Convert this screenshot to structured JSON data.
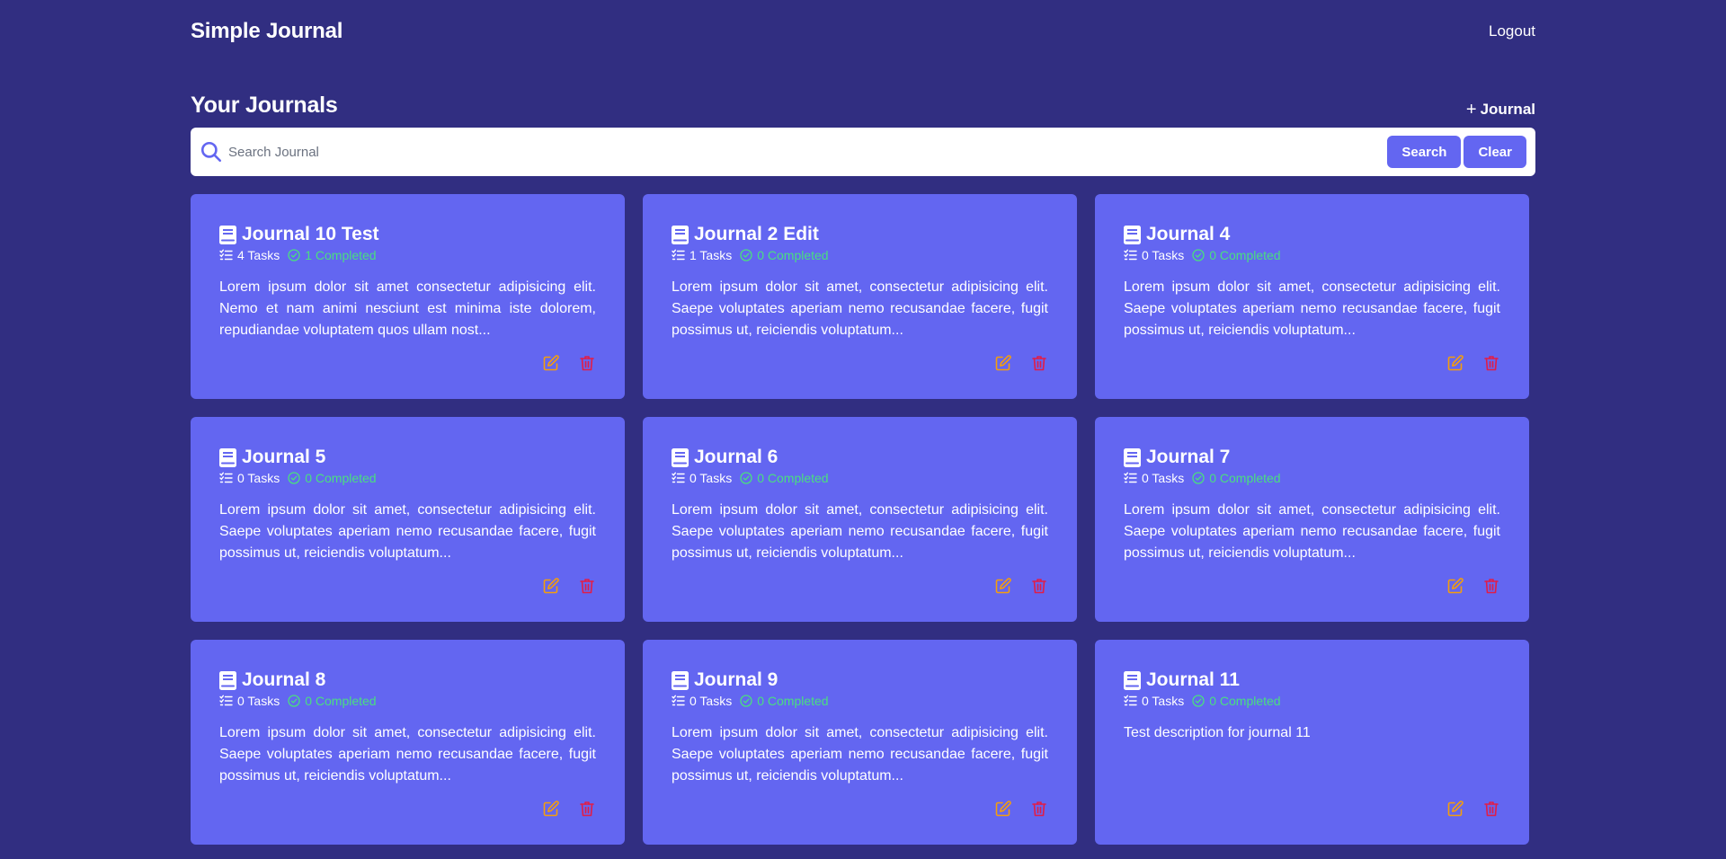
{
  "app": {
    "title": "Simple Journal",
    "logout_label": "Logout"
  },
  "page": {
    "title": "Your Journals",
    "add_label": "Journal"
  },
  "search": {
    "placeholder": "Search Journal",
    "value": "",
    "search_label": "Search",
    "clear_label": "Clear"
  },
  "colors": {
    "background": "#312e81",
    "card": "#6366f1",
    "completed": "#4ade80",
    "edit": "#f59e0b",
    "delete": "#e11d48"
  },
  "icons": {
    "book": "book-icon",
    "tasks": "tasks-list-icon",
    "completed": "check-circle-icon",
    "edit": "edit-icon",
    "delete": "trash-icon",
    "search": "search-icon",
    "add": "plus-icon"
  },
  "journals": [
    {
      "title": "Journal 10 Test",
      "tasks": "4 Tasks",
      "completed": "1 Completed",
      "description": "Lorem ipsum dolor sit amet consectetur adipisicing elit. Nemo et nam animi nesciunt est minima iste dolorem, repudiandae voluptatem quos ullam nost..."
    },
    {
      "title": "Journal 2 Edit",
      "tasks": "1 Tasks",
      "completed": "0 Completed",
      "description": "Lorem ipsum dolor sit amet, consectetur adipisicing elit. Saepe voluptates aperiam nemo recusandae facere, fugit possimus ut, reiciendis voluptatum..."
    },
    {
      "title": "Journal 4",
      "tasks": "0 Tasks",
      "completed": "0 Completed",
      "description": "Lorem ipsum dolor sit amet, consectetur adipisicing elit. Saepe voluptates aperiam nemo recusandae facere, fugit possimus ut, reiciendis voluptatum..."
    },
    {
      "title": "Journal 5",
      "tasks": "0 Tasks",
      "completed": "0 Completed",
      "description": "Lorem ipsum dolor sit amet, consectetur adipisicing elit. Saepe voluptates aperiam nemo recusandae facere, fugit possimus ut, reiciendis voluptatum..."
    },
    {
      "title": "Journal 6",
      "tasks": "0 Tasks",
      "completed": "0 Completed",
      "description": "Lorem ipsum dolor sit amet, consectetur adipisicing elit. Saepe voluptates aperiam nemo recusandae facere, fugit possimus ut, reiciendis voluptatum..."
    },
    {
      "title": "Journal 7",
      "tasks": "0 Tasks",
      "completed": "0 Completed",
      "description": "Lorem ipsum dolor sit amet, consectetur adipisicing elit. Saepe voluptates aperiam nemo recusandae facere, fugit possimus ut, reiciendis voluptatum..."
    },
    {
      "title": "Journal 8",
      "tasks": "0 Tasks",
      "completed": "0 Completed",
      "description": "Lorem ipsum dolor sit amet, consectetur adipisicing elit. Saepe voluptates aperiam nemo recusandae facere, fugit possimus ut, reiciendis voluptatum..."
    },
    {
      "title": "Journal 9",
      "tasks": "0 Tasks",
      "completed": "0 Completed",
      "description": "Lorem ipsum dolor sit amet, consectetur adipisicing elit. Saepe voluptates aperiam nemo recusandae facere, fugit possimus ut, reiciendis voluptatum..."
    },
    {
      "title": "Journal 11",
      "tasks": "0 Tasks",
      "completed": "0 Completed",
      "description": "Test description for journal 11"
    }
  ]
}
